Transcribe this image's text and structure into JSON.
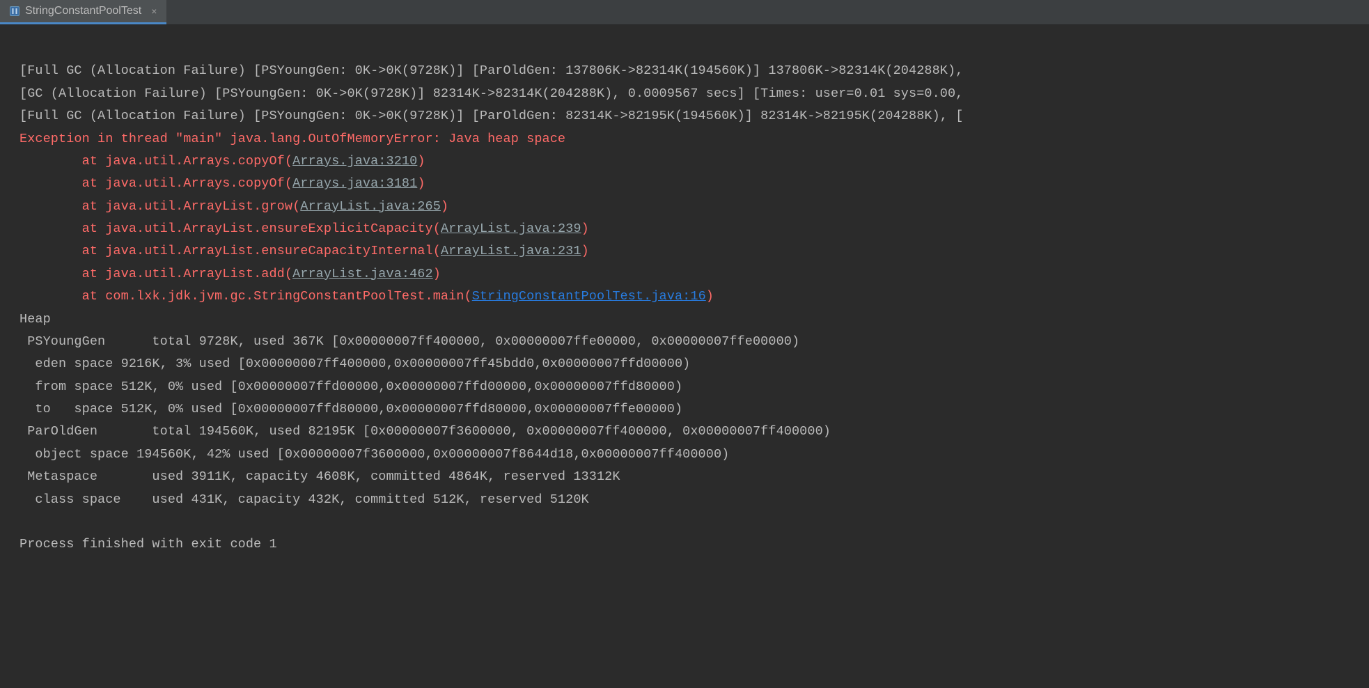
{
  "tab": {
    "title": "StringConstantPoolTest",
    "close": "×"
  },
  "console": {
    "gc1": "[Full GC (Allocation Failure) [PSYoungGen: 0K->0K(9728K)] [ParOldGen: 137806K->82314K(194560K)] 137806K->82314K(204288K),",
    "gc2": "[GC (Allocation Failure) [PSYoungGen: 0K->0K(9728K)] 82314K->82314K(204288K), 0.0009567 secs] [Times: user=0.01 sys=0.00,",
    "gc3": "[Full GC (Allocation Failure) [PSYoungGen: 0K->0K(9728K)] [ParOldGen: 82314K->82195K(194560K)] 82314K->82195K(204288K), [",
    "exception": "Exception in thread \"main\" java.lang.OutOfMemoryError: Java heap space",
    "stack": [
      {
        "indent": "\tat ",
        "method": "java.util.Arrays.copyOf",
        "open": "(",
        "link": "Arrays.java:3210",
        "close": ")",
        "blue": false
      },
      {
        "indent": "\tat ",
        "method": "java.util.Arrays.copyOf",
        "open": "(",
        "link": "Arrays.java:3181",
        "close": ")",
        "blue": false
      },
      {
        "indent": "\tat ",
        "method": "java.util.ArrayList.grow",
        "open": "(",
        "link": "ArrayList.java:265",
        "close": ")",
        "blue": false
      },
      {
        "indent": "\tat ",
        "method": "java.util.ArrayList.ensureExplicitCapacity",
        "open": "(",
        "link": "ArrayList.java:239",
        "close": ")",
        "blue": false
      },
      {
        "indent": "\tat ",
        "method": "java.util.ArrayList.ensureCapacityInternal",
        "open": "(",
        "link": "ArrayList.java:231",
        "close": ")",
        "blue": false
      },
      {
        "indent": "\tat ",
        "method": "java.util.ArrayList.add",
        "open": "(",
        "link": "ArrayList.java:462",
        "close": ")",
        "blue": false
      },
      {
        "indent": "\tat ",
        "method": "com.lxk.jdk.jvm.gc.StringConstantPoolTest.main",
        "open": "(",
        "link": "StringConstantPoolTest.java:16",
        "close": ")",
        "blue": true
      }
    ],
    "heap": [
      "Heap",
      " PSYoungGen      total 9728K, used 367K [0x00000007ff400000, 0x00000007ffe00000, 0x00000007ffe00000)",
      "  eden space 9216K, 3% used [0x00000007ff400000,0x00000007ff45bdd0,0x00000007ffd00000)",
      "  from space 512K, 0% used [0x00000007ffd00000,0x00000007ffd00000,0x00000007ffd80000)",
      "  to   space 512K, 0% used [0x00000007ffd80000,0x00000007ffd80000,0x00000007ffe00000)",
      " ParOldGen       total 194560K, used 82195K [0x00000007f3600000, 0x00000007ff400000, 0x00000007ff400000)",
      "  object space 194560K, 42% used [0x00000007f3600000,0x00000007f8644d18,0x00000007ff400000)",
      " Metaspace       used 3911K, capacity 4608K, committed 4864K, reserved 13312K",
      "  class space    used 431K, capacity 432K, committed 512K, reserved 5120K"
    ],
    "blank": "",
    "exit": "Process finished with exit code 1"
  }
}
